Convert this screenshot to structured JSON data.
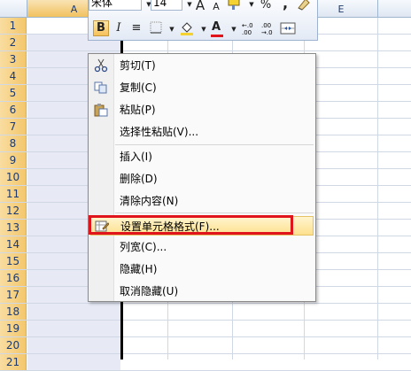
{
  "sheet": {
    "column_a": "A",
    "column_e": "E",
    "rows": [
      "1",
      "2",
      "3",
      "4",
      "5",
      "6",
      "7",
      "8",
      "9",
      "10",
      "11",
      "12",
      "13",
      "14",
      "15",
      "16",
      "17",
      "18",
      "19",
      "20",
      "21"
    ]
  },
  "mini_toolbar": {
    "font_name": "宋体",
    "font_size": "14",
    "grow_font": "A",
    "shrink_font": "A",
    "percent": "%",
    "comma": ",",
    "bold": "B",
    "italic": "I",
    "align_center": "≡",
    "font_color_letter": "A",
    "increase_decimal": ".0→.00",
    "decrease_decimal": ".00→.0",
    "highlight_color": "#f4d231",
    "font_color": "#e0141b"
  },
  "context_menu": {
    "items": [
      {
        "label": "剪切(T)",
        "icon": "scissors-icon"
      },
      {
        "label": "复制(C)",
        "icon": "copy-icon"
      },
      {
        "label": "粘贴(P)",
        "icon": "paste-icon"
      },
      {
        "label": "选择性粘贴(V)..."
      },
      {
        "label": "插入(I)"
      },
      {
        "label": "删除(D)"
      },
      {
        "label": "清除内容(N)"
      },
      {
        "label": "设置单元格格式(F)...",
        "icon": "format-cells-icon",
        "highlighted": true
      },
      {
        "label": "列宽(C)..."
      },
      {
        "label": "隐藏(H)"
      },
      {
        "label": "取消隐藏(U)"
      }
    ],
    "highlight_border_color": "#e0141b"
  }
}
